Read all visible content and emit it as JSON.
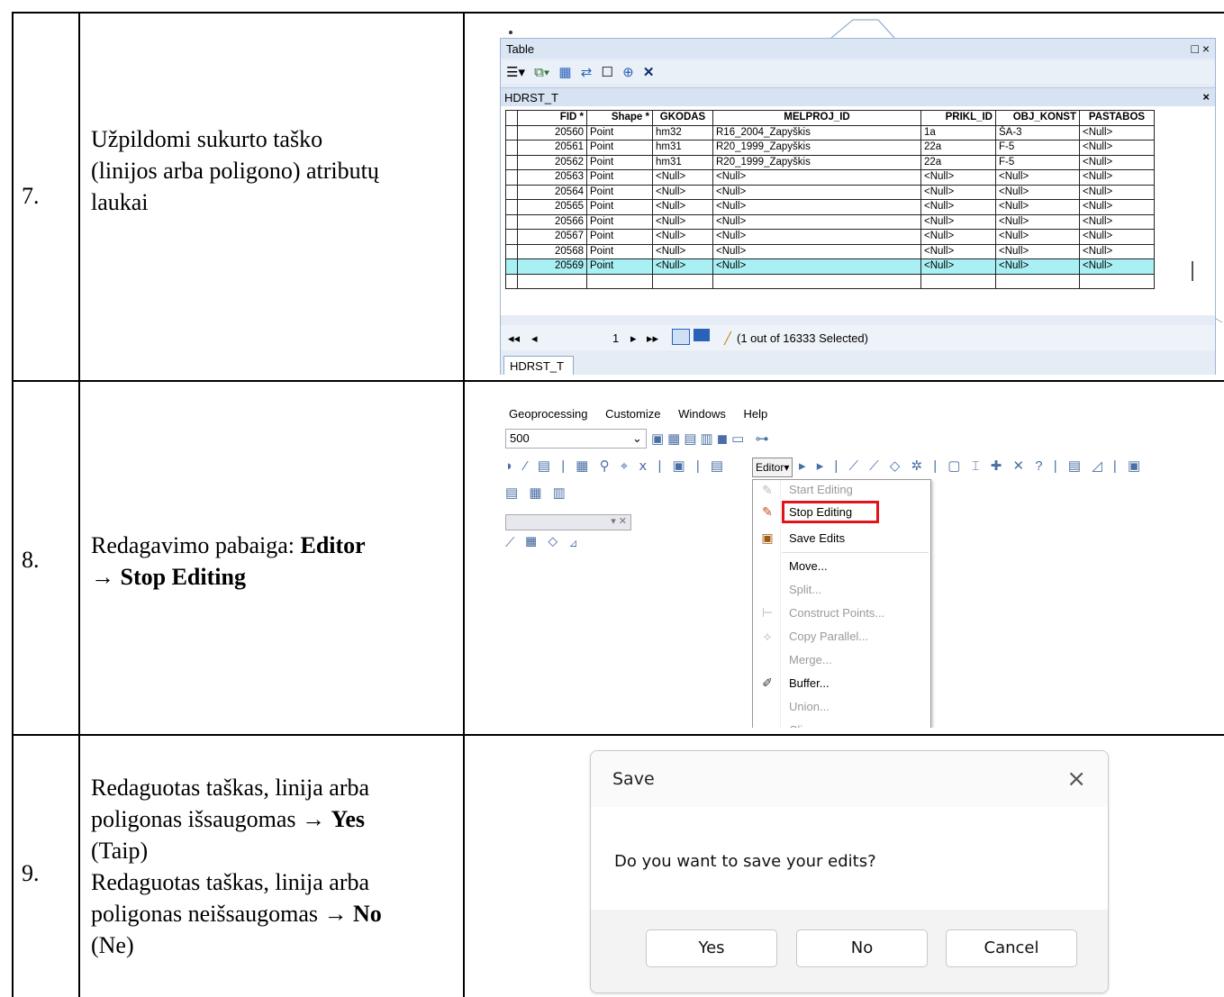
{
  "rows": [
    {
      "num": "7.",
      "desc": [
        "Užpildomi sukurto taško",
        "(linijos arba poligono) atributų",
        "laukai"
      ]
    },
    {
      "num": "8.",
      "desc_pre": "Redagavimo pabaiga: ",
      "desc_b1": "Editor",
      "desc_b2": "→ Stop Editing"
    },
    {
      "num": "9.",
      "line1": "Redaguotas taškas, linija arba",
      "line2_pre": "poligonas išsaugomas → ",
      "line2_b": "Yes",
      "line3": "(Taip)",
      "line4": "Redaguotas taškas, linija arba",
      "line5_pre": "poligonas neišsaugomas → ",
      "line5_b": "No",
      "line6": "(Ne)"
    }
  ],
  "table_window": {
    "title": "Table",
    "controls": "□ ×",
    "tab_title": "HDRST_T",
    "columns": [
      "FID *",
      "Shape *",
      "GKODAS",
      "MELPROJ_ID",
      "PRIKL_ID",
      "OBJ_KONST",
      "PASTABOS"
    ],
    "records": [
      [
        "20560",
        "Point",
        "hm32",
        "R16_2004_Zapyškis",
        "1a",
        "ŠA-3",
        "<Null>"
      ],
      [
        "20561",
        "Point",
        "hm31",
        "R20_1999_Zapyškis",
        "22a",
        "F-5",
        "<Null>"
      ],
      [
        "20562",
        "Point",
        "hm31",
        "R20_1999_Zapyškis",
        "22a",
        "F-5",
        "<Null>"
      ],
      [
        "20563",
        "Point",
        "<Null>",
        "<Null>",
        "<Null>",
        "<Null>",
        "<Null>"
      ],
      [
        "20564",
        "Point",
        "<Null>",
        "<Null>",
        "<Null>",
        "<Null>",
        "<Null>"
      ],
      [
        "20565",
        "Point",
        "<Null>",
        "<Null>",
        "<Null>",
        "<Null>",
        "<Null>"
      ],
      [
        "20566",
        "Point",
        "<Null>",
        "<Null>",
        "<Null>",
        "<Null>",
        "<Null>"
      ],
      [
        "20567",
        "Point",
        "<Null>",
        "<Null>",
        "<Null>",
        "<Null>",
        "<Null>"
      ],
      [
        "20568",
        "Point",
        "<Null>",
        "<Null>",
        "<Null>",
        "<Null>",
        "<Null>"
      ],
      [
        "20569",
        "Point",
        "<Null>",
        "<Null>",
        "<Null>",
        "<Null>",
        "<Null>"
      ]
    ],
    "highlighted_record": "20569",
    "nav_first": "◂◂",
    "nav_prev": "◂",
    "nav_page": "1",
    "nav_next": "▸",
    "nav_last": "▸▸",
    "selection_status": "(1 out of 16333 Selected)",
    "bottom_tab": "HDRST_T",
    "highlight_color": "#a8f0f4"
  },
  "arcmap": {
    "menus": [
      "Geoprocessing",
      "Customize",
      "Windows",
      "Help"
    ],
    "scale_value": "500",
    "editor_button": "Editor▾",
    "editor_menu": [
      {
        "label": "Start Editing",
        "enabled": false
      },
      {
        "label": "Stop Editing",
        "enabled": true
      },
      {
        "label": "Save Edits",
        "enabled": true
      },
      {
        "label": "Move...",
        "enabled": true
      },
      {
        "label": "Split...",
        "enabled": false
      },
      {
        "label": "Construct Points...",
        "enabled": false
      },
      {
        "label": "Copy Parallel...",
        "enabled": false
      },
      {
        "label": "Merge...",
        "enabled": false
      },
      {
        "label": "Buffer...",
        "enabled": true
      },
      {
        "label": "Union...",
        "enabled": false
      },
      {
        "label": "Clip...",
        "enabled": false
      }
    ],
    "highlight_color": "#e0141b"
  },
  "dialog": {
    "title": "Save",
    "close_icon": "×",
    "message": "Do you want to save your edits?",
    "buttons": [
      "Yes",
      "No",
      "Cancel"
    ]
  }
}
